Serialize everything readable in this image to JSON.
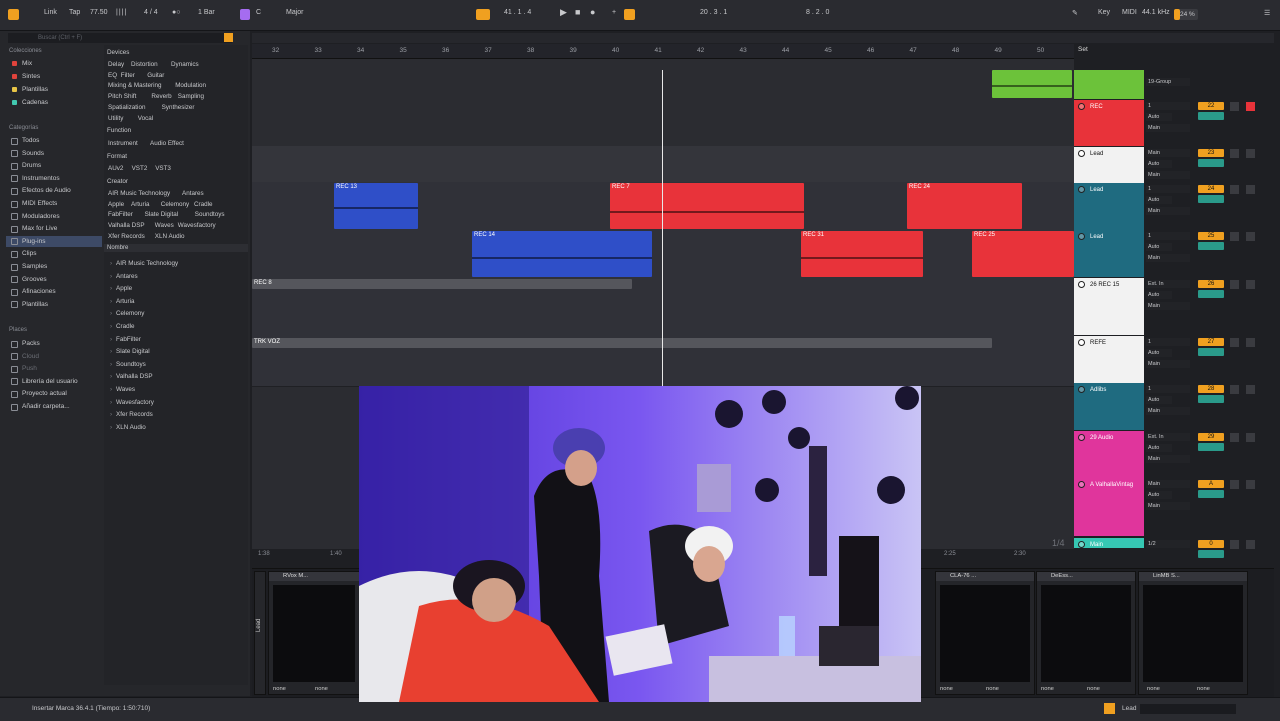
{
  "topbar": {
    "link": "Link",
    "tap": "Tap",
    "tempo": "77.50",
    "signature": "4 / 4",
    "metro": "1 Bar",
    "key_root": "C",
    "key_scale": "Major",
    "position": "41 .  1 .  4",
    "loop_start": "20 .  3 .  1",
    "loop_len": "8 .  2 .  0",
    "key_label": "Key",
    "midi_label": "MIDI",
    "sample_rate": "44.1 kHz",
    "cpu": "24 %"
  },
  "browser": {
    "search_placeholder": "Buscar (Ctrl + F)",
    "collections_header": "Colecciones",
    "collections": [
      {
        "label": "Mix",
        "color": "#e0433c"
      },
      {
        "label": "Sintes",
        "color": "#e0433c"
      },
      {
        "label": "Plantillas",
        "color": "#e8c547"
      },
      {
        "label": "Cadenas",
        "color": "#42c8b0"
      }
    ],
    "categories_header": "Categorías",
    "categories": [
      "Todos",
      "Sounds",
      "Drums",
      "Instrumentos",
      "Efectos de Audio",
      "MIDI Effects",
      "Moduladores",
      "Max for Live",
      "Plug-ins",
      "Clips",
      "Samples",
      "Grooves",
      "Afinaciones",
      "Plantillas"
    ],
    "selected_category": "Plug-ins",
    "places_header": "Places",
    "places": [
      "Packs",
      "Cloud",
      "Push",
      "Librería del usuario",
      "Proyecto actual",
      "Añadir carpeta..."
    ],
    "devices_header": "Devices",
    "devices_tags": [
      [
        "Delay",
        "Distortion",
        "Dynamics"
      ],
      [
        "EQ",
        "Filter",
        "Guitar"
      ],
      [
        "Mixing & Mastering",
        "Modulation"
      ],
      [
        "Pitch Shift",
        "Reverb",
        "Sampling"
      ],
      [
        "Spatialization",
        "Synthesizer"
      ],
      [
        "Utility",
        "Vocal"
      ]
    ],
    "function_header": "Function",
    "function_tags": [
      "Instrument",
      "Audio Effect"
    ],
    "format_header": "Format",
    "format_tags": [
      "AUv2",
      "VST2",
      "VST3"
    ],
    "creator_header": "Creator",
    "creator_tags": [
      [
        "AIR Music Technology",
        "Antares"
      ],
      [
        "Apple",
        "Arturia",
        "Celemony",
        "Cradle"
      ],
      [
        "FabFilter",
        "Slate Digital",
        "Soundtoys"
      ],
      [
        "Valhalla DSP",
        "Waves",
        "Wavesfactory"
      ],
      [
        "Xfer Records",
        "XLN Audio"
      ]
    ],
    "name_header": "Nombre",
    "names": [
      "AIR Music Technology",
      "Antares",
      "Apple",
      "Arturia",
      "Celemony",
      "Cradle",
      "FabFilter",
      "Slate Digital",
      "Soundtoys",
      "Valhalla DSP",
      "Waves",
      "Wavesfactory",
      "Xfer Records",
      "XLN Audio"
    ]
  },
  "ruler": {
    "bars": [
      "32",
      "33",
      "34",
      "35",
      "36",
      "37",
      "38",
      "39",
      "40",
      "41",
      "42",
      "43",
      "44",
      "45",
      "46",
      "47",
      "48",
      "49",
      "50"
    ],
    "set_label": "Set"
  },
  "clips": [
    {
      "name": "REC 13",
      "color": "#2f4fc8"
    },
    {
      "name": "REC 14",
      "color": "#2f4fc8"
    },
    {
      "name": "REC 7",
      "color": "#e8333a"
    },
    {
      "name": "REC 20",
      "color": "#e8333a"
    },
    {
      "name": "REC 24",
      "color": "#e8333a"
    },
    {
      "name": "REC 22",
      "color": "#e8333a"
    },
    {
      "name": "REC 31",
      "color": "#e8333a"
    },
    {
      "name": "REC 25",
      "color": "#e8333a"
    },
    {
      "name": "REC 8",
      "color": "#55565c"
    },
    {
      "name": "TRK VOZ",
      "color": "#55565c"
    }
  ],
  "tracks": [
    {
      "name": "REC",
      "color": "#e8333a",
      "io": "1",
      "num": "22"
    },
    {
      "name": "Lead",
      "color": "#f2f2f2",
      "io": "Main",
      "num": "23"
    },
    {
      "name": "Lead",
      "color": "#1f6b80",
      "io": "1",
      "num": "24"
    },
    {
      "name": "Lead",
      "color": "#1f6b80",
      "io": "1",
      "num": "25"
    },
    {
      "name": "26 REC 15",
      "color": "#f2f2f2",
      "io": "Ext. In",
      "num": "26"
    },
    {
      "name": "REFE",
      "color": "#f2f2f2",
      "io": "1",
      "num": "27"
    },
    {
      "name": "Adlibs",
      "color": "#1f6b80",
      "io": "1",
      "num": "28"
    },
    {
      "name": "29 Audio",
      "color": "#e0359c",
      "io": "Ext. In",
      "num": "29"
    },
    {
      "name": "A ValhallaVintag",
      "color": "#e0359c",
      "io": "Main",
      "num": "A"
    },
    {
      "name": "Main",
      "color": "#36c7b3",
      "io": "1/2",
      "num": "0"
    }
  ],
  "track_io": {
    "auto": "Auto",
    "off": "Off",
    "main": "Main",
    "lead": "Lead",
    "group": "19-Group",
    "ext": "Ext. In",
    "post": "Post"
  },
  "timeline_times": [
    "1:38",
    "1:40",
    "2:25",
    "2:30"
  ],
  "zoom_fraction": "1/4",
  "devices": [
    {
      "name": "RVox M..."
    },
    {
      "name": "CLA-76 ..."
    },
    {
      "name": "DeEss..."
    },
    {
      "name": "LinMB S..."
    }
  ],
  "device_none": "none",
  "status": {
    "message": "Insertar Marca 36.4.1 (Tiempo: 1:50:710)",
    "track": "Lead"
  },
  "colors": {
    "accent": "#f0a020",
    "green_clip": "#6cc23a",
    "red": "#e8333a",
    "blue": "#2f4fc8"
  }
}
